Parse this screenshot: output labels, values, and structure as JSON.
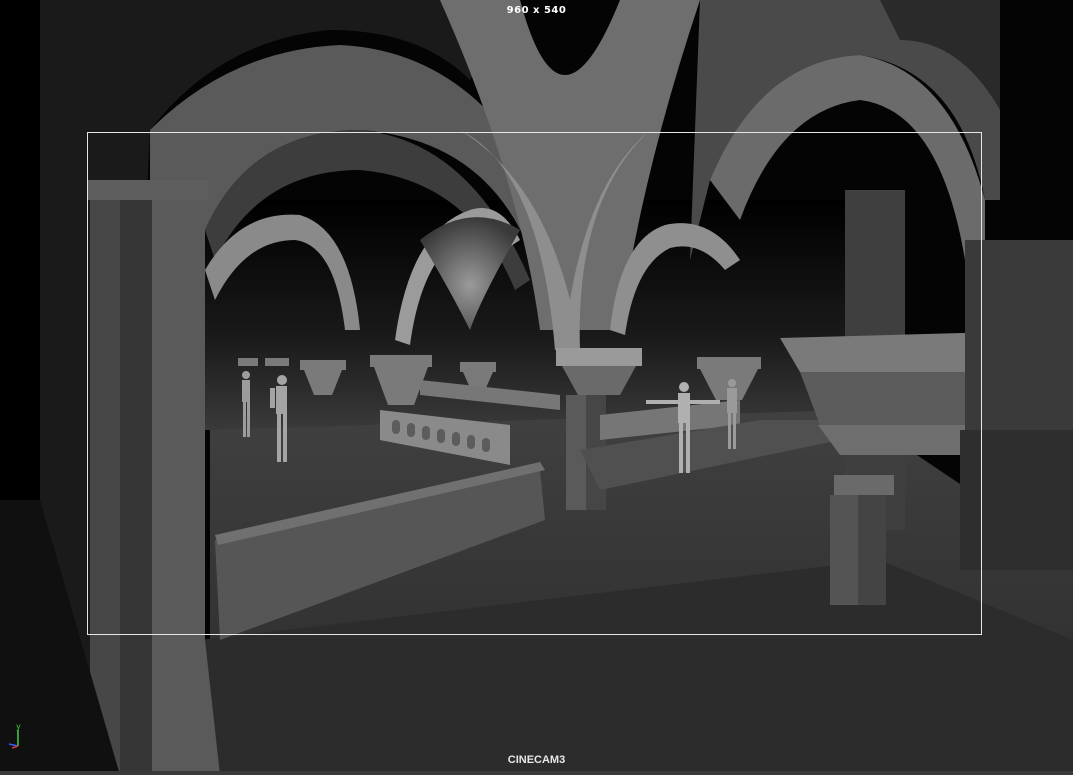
{
  "viewport": {
    "resolution_label": "960 x 540",
    "camera_name": "CINECAM3"
  },
  "axis_gizmo": {
    "y_label": "y"
  },
  "colors": {
    "gate_border": "#e6e6e6",
    "axis_y": "#3fd13f",
    "axis_z": "#3a5bff",
    "axis_x": "#d23a3a"
  }
}
